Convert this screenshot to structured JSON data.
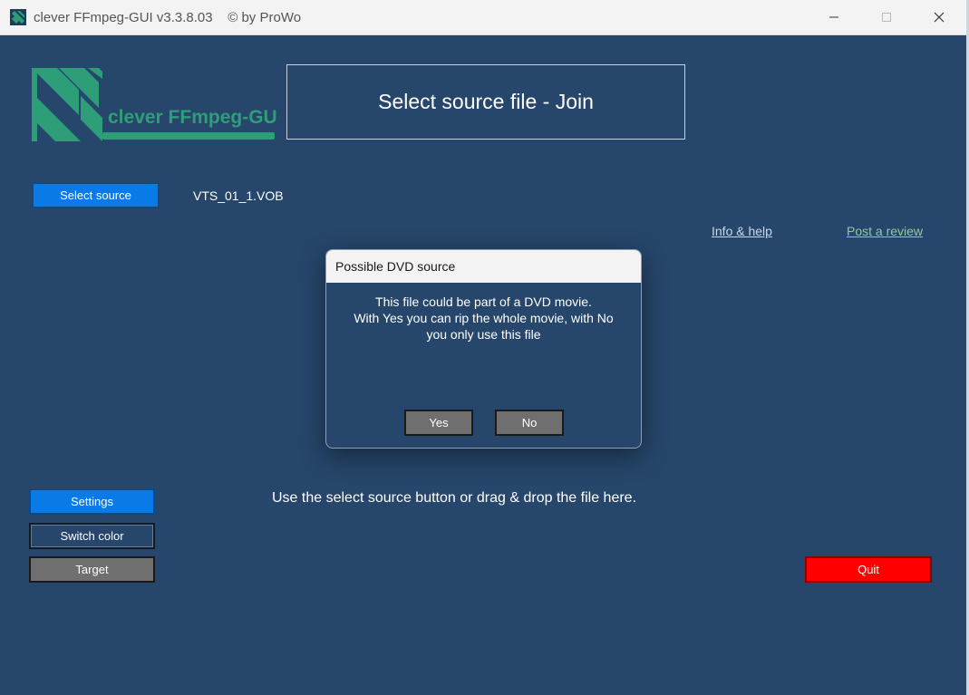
{
  "titlebar": {
    "title": "clever FFmpeg-GUI v3.3.8.03    © by ProWo",
    "minimize_icon": "minimize-icon",
    "maximize_icon": "maximize-icon",
    "close_icon": "close-icon"
  },
  "logo": {
    "text": "clever FFmpeg-GUI"
  },
  "header": {
    "title": "Select source file - Join"
  },
  "source": {
    "button_label": "Select source",
    "filename": "VTS_01_1.VOB"
  },
  "links": {
    "info_help": "Info & help",
    "post_review": "Post a review"
  },
  "dialog": {
    "title": "Possible DVD source",
    "message_lines": [
      "This file could be part of a DVD movie.",
      "With Yes you can rip the whole movie, with No",
      "you only use this file"
    ],
    "yes_label": "Yes",
    "no_label": "No"
  },
  "drop_hint": "Use the select source button or drag & drop the file here.",
  "left_buttons": {
    "settings": "Settings",
    "switch_color": "Switch color",
    "target": "Target"
  },
  "quit_label": "Quit",
  "colors": {
    "background": "#26466b",
    "button_blue": "#0a7ae6",
    "button_gray": "#6f6f6f",
    "quit_red": "#ff0000",
    "logo_green": "#2e9e78",
    "link_review": "#8fc9a0",
    "link_info": "#c8d8ec"
  }
}
